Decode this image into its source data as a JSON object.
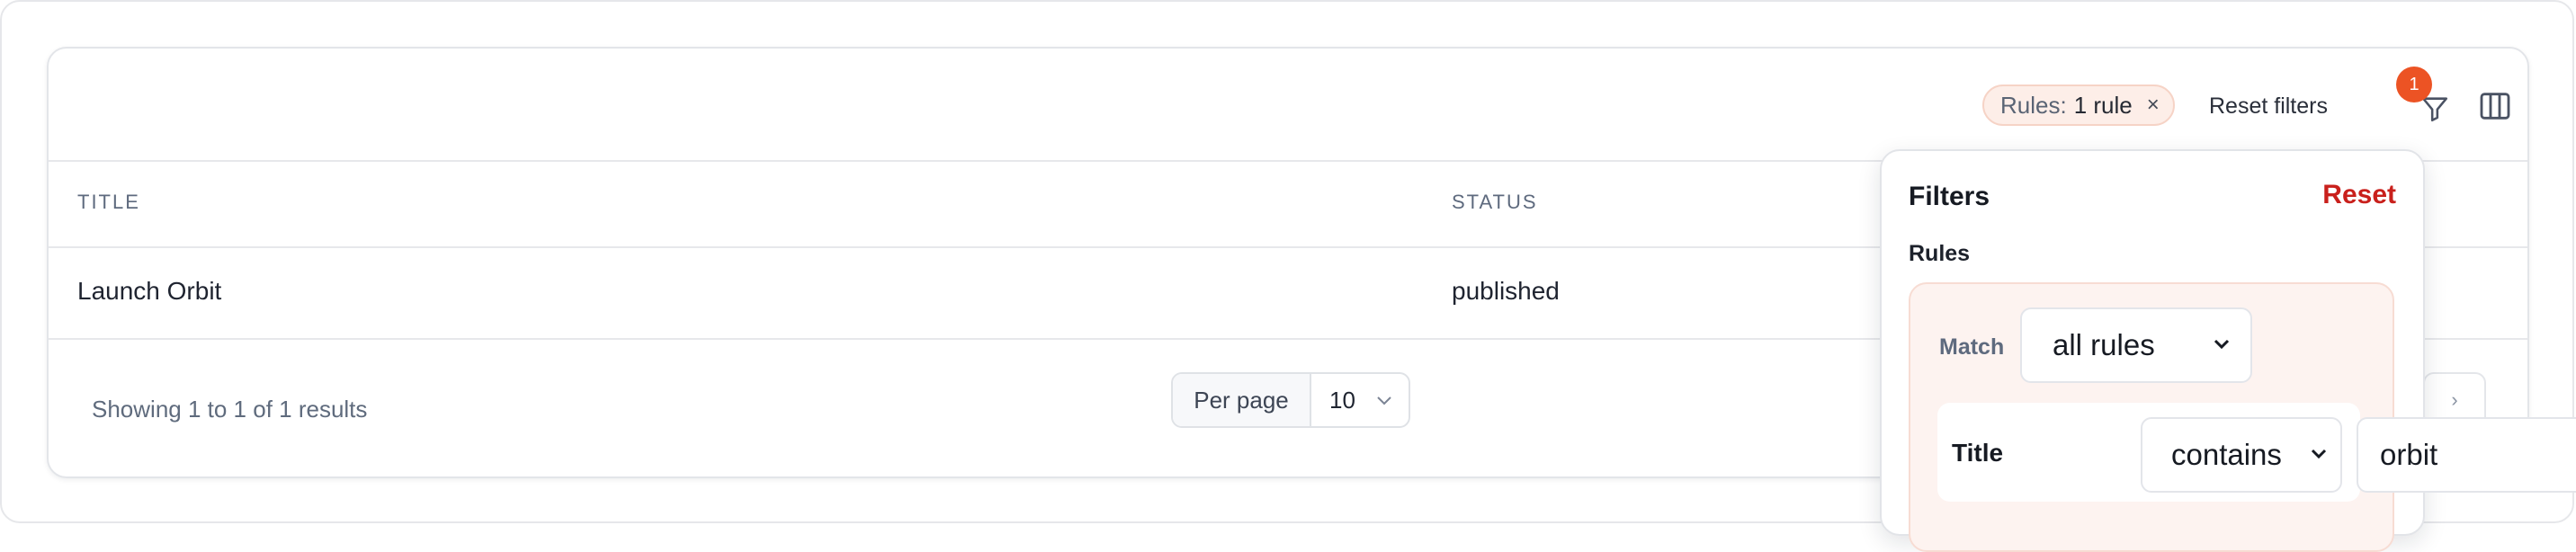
{
  "toolbar": {
    "chip": {
      "key": "Rules:",
      "value": "1 rule",
      "remove_glyph": "×"
    },
    "reset_filters_label": "Reset filters",
    "filter_badge_count": "1",
    "filter_icon": "funnel-icon",
    "columns_icon": "columns-icon"
  },
  "table": {
    "columns": [
      "TITLE",
      "STATUS"
    ],
    "rows": [
      {
        "title": "Launch Orbit",
        "status": "published"
      }
    ]
  },
  "footer": {
    "showing": "Showing 1 to 1 of 1 results",
    "per_page_label": "Per page",
    "per_page_value": "10",
    "next_glyph": "›"
  },
  "filter_panel": {
    "title": "Filters",
    "reset_label": "Reset",
    "rules_label": "Rules",
    "match_label": "Match",
    "match_value": "all rules",
    "rule": {
      "field": "Title",
      "operator": "contains",
      "value": "orbit"
    }
  },
  "colors": {
    "accent_red": "#c9201c",
    "badge_orange": "#ec5324",
    "chip_bg": "#fdeee8"
  }
}
